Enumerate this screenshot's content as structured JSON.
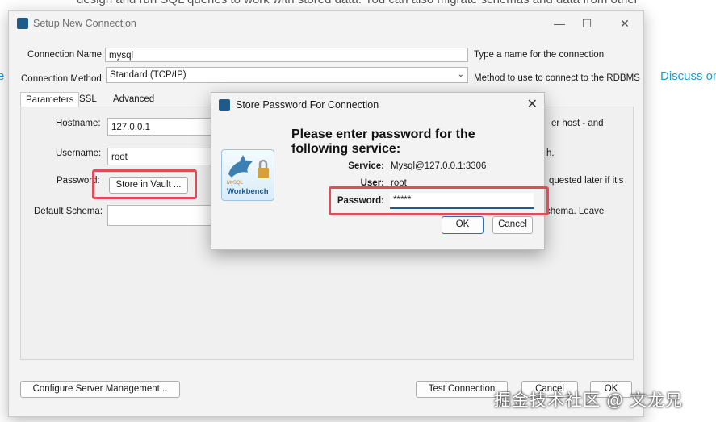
{
  "background": {
    "text_top": "design and run SQL queries to work with stored data. You can also migrate schemas and data from other",
    "text_left": "e",
    "text_right": "Discuss on",
    "watermark": "掘金技术社区 @ 文龙兄"
  },
  "window": {
    "title": "Setup New Connection",
    "controls": {
      "minimize": "—",
      "maximize": "☐",
      "close": "✕"
    }
  },
  "form": {
    "connection_name_label": "Connection Name:",
    "connection_name_value": "mysql",
    "connection_name_hint": "Type a name for the connection",
    "connection_method_label": "Connection Method:",
    "connection_method_value": "Standard (TCP/IP)",
    "connection_method_hint": "Method to use to connect to the RDBMS",
    "tabs": [
      "Parameters",
      "SSL",
      "Advanced"
    ],
    "hostname_label": "Hostname:",
    "hostname_value": "127.0.0.1",
    "hostname_hint": "er host - and",
    "username_label": "Username:",
    "username_value": "root",
    "username_hint": "h.",
    "password_label": "Password:",
    "store_vault_label": "Store in Vault ...",
    "password_hint": "quested later if it's",
    "default_schema_label": "Default Schema:",
    "default_schema_hint": "chema. Leave"
  },
  "footer": {
    "configure_label": "Configure Server Management...",
    "test_label": "Test Connection",
    "cancel_label": "Cancel",
    "ok_label": "OK"
  },
  "dialog": {
    "title": "Store Password For Connection",
    "close": "✕",
    "heading": "Please enter password for the following service:",
    "service_label": "Service:",
    "service_value": "Mysql@127.0.0.1:3306",
    "user_label": "User:",
    "user_value": "root",
    "password_label": "Password:",
    "password_value": "*****",
    "ok_label": "OK",
    "cancel_label": "Cancel",
    "logo_text": "Workbench",
    "logo_small": "MySQL"
  },
  "colors": {
    "highlight": "#e44b5a",
    "accent": "#1a9bd7"
  }
}
